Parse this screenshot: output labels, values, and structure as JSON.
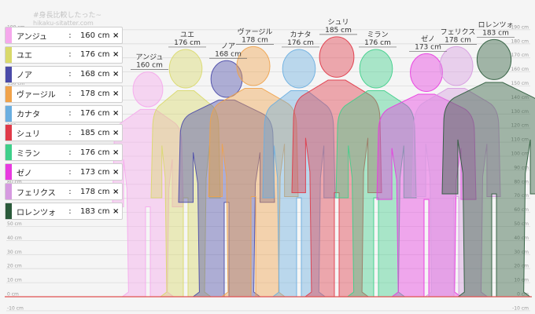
{
  "app": {
    "watermark_title": "#身長比較したった~",
    "watermark_url": "hikaku-sitatter.com"
  },
  "controls": {
    "remove_glyph": "×",
    "colon": ":"
  },
  "chart_data": {
    "type": "bar",
    "unit": "cm",
    "ylim": [
      -10,
      190
    ],
    "y_ticks": [
      -10,
      0,
      10,
      20,
      30,
      40,
      50,
      60,
      70,
      80,
      90,
      100,
      110,
      120,
      130,
      140,
      150,
      160,
      170,
      180,
      190
    ],
    "grid": true,
    "baseline": 0,
    "baseline_color": "#e05050",
    "categories": [
      "アンジュ",
      "ユエ",
      "ノア",
      "ヴァージル",
      "カナタ",
      "シュリ",
      "ミラン",
      "ゼノ",
      "フェリクス",
      "ロレンツォ"
    ],
    "series": [
      {
        "name": "アンジュ",
        "value": 160,
        "color": "#f5a8ec"
      },
      {
        "name": "ユエ",
        "value": 176,
        "color": "#d9d96a"
      },
      {
        "name": "ノア",
        "value": 168,
        "color": "#4a4aa8"
      },
      {
        "name": "ヴァージル",
        "value": 178,
        "color": "#f0a24a"
      },
      {
        "name": "カナタ",
        "value": 176,
        "color": "#6aaee0"
      },
      {
        "name": "シュリ",
        "value": 185,
        "color": "#e03a48"
      },
      {
        "name": "ミラン",
        "value": 176,
        "color": "#3ecf8a"
      },
      {
        "name": "ゼノ",
        "value": 173,
        "color": "#e83ae0"
      },
      {
        "name": "フェリクス",
        "value": 178,
        "color": "#d69ae0"
      },
      {
        "name": "ロレンツォ",
        "value": 183,
        "color": "#2a5a3a"
      }
    ]
  }
}
